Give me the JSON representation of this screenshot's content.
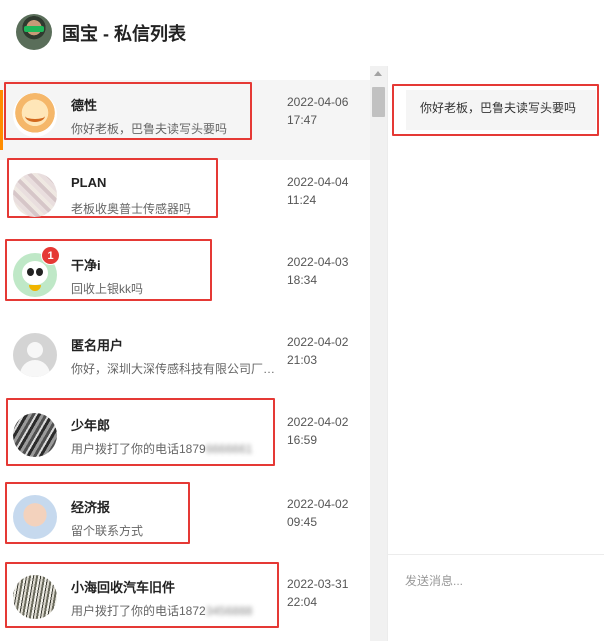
{
  "header": {
    "title": "国宝 - 私信列表"
  },
  "conversations": [
    {
      "name": "德性",
      "message": "你好老板，巴鲁夫读写头要吗",
      "date": "2022-04-06",
      "time": "17:47"
    },
    {
      "name": "PLAN",
      "message": "老板收奥普士传感器吗",
      "date": "2022-04-04",
      "time": "11:24"
    },
    {
      "name": "干净i",
      "message": "回收上银kk吗",
      "date": "2022-04-03",
      "time": "18:34",
      "badge": "1"
    },
    {
      "name": "匿名用户",
      "message": "你好，深圳大深传感科技有限公司厂家可",
      "date": "2022-04-02",
      "time": "21:03"
    },
    {
      "name": "少年郎",
      "message": "用户拨打了你的电话1879",
      "message_hidden": "6666661",
      "date": "2022-04-02",
      "time": "16:59"
    },
    {
      "name": "经济报",
      "message": "留个联系方式",
      "date": "2022-04-02",
      "time": "09:45"
    },
    {
      "name": "小海回收汽车旧件",
      "message": "用户拨打了你的电话1872",
      "message_hidden": "3456888",
      "date": "2022-03-31",
      "time": "22:04"
    }
  ],
  "detail": {
    "message": "你好老板，巴鲁夫读写头要吗",
    "input_placeholder": "发送消息..."
  },
  "colors": {
    "highlight_border": "#e53935",
    "active_accent": "#ff8c00",
    "badge": "#e53935"
  }
}
